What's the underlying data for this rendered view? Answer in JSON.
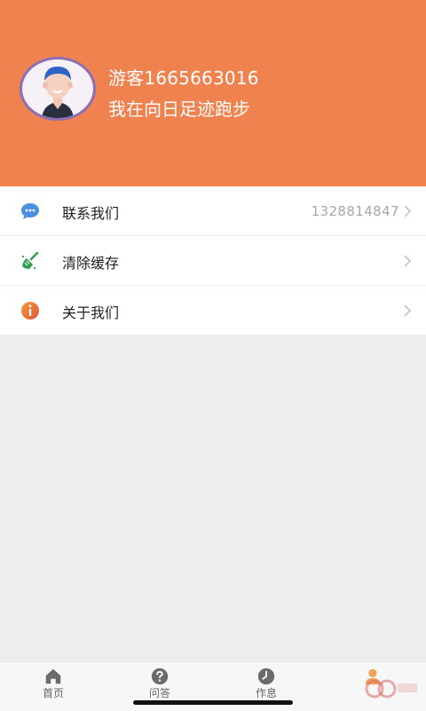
{
  "profile": {
    "username": "游客1665663016",
    "motto": "我在向日足迹跑步"
  },
  "menu": {
    "items": [
      {
        "label": "联系我们",
        "value": "1328814847",
        "icon": "chat-bubble-icon"
      },
      {
        "label": "清除缓存",
        "value": "",
        "icon": "broom-icon"
      },
      {
        "label": "关于我们",
        "value": "",
        "icon": "info-icon"
      }
    ]
  },
  "tabbar": {
    "tabs": [
      {
        "label": "首页",
        "icon": "home-icon"
      },
      {
        "label": "问答",
        "icon": "question-icon"
      },
      {
        "label": "作息",
        "icon": "clock-icon"
      },
      {
        "label": "",
        "icon": "profile-icon"
      }
    ]
  },
  "colors": {
    "header": "#f0824f",
    "avatar_border": "#8b6fb6",
    "chat_icon": "#4a90e2",
    "broom_icon": "#2e9e4f",
    "info_icon": "#e86a3a"
  }
}
